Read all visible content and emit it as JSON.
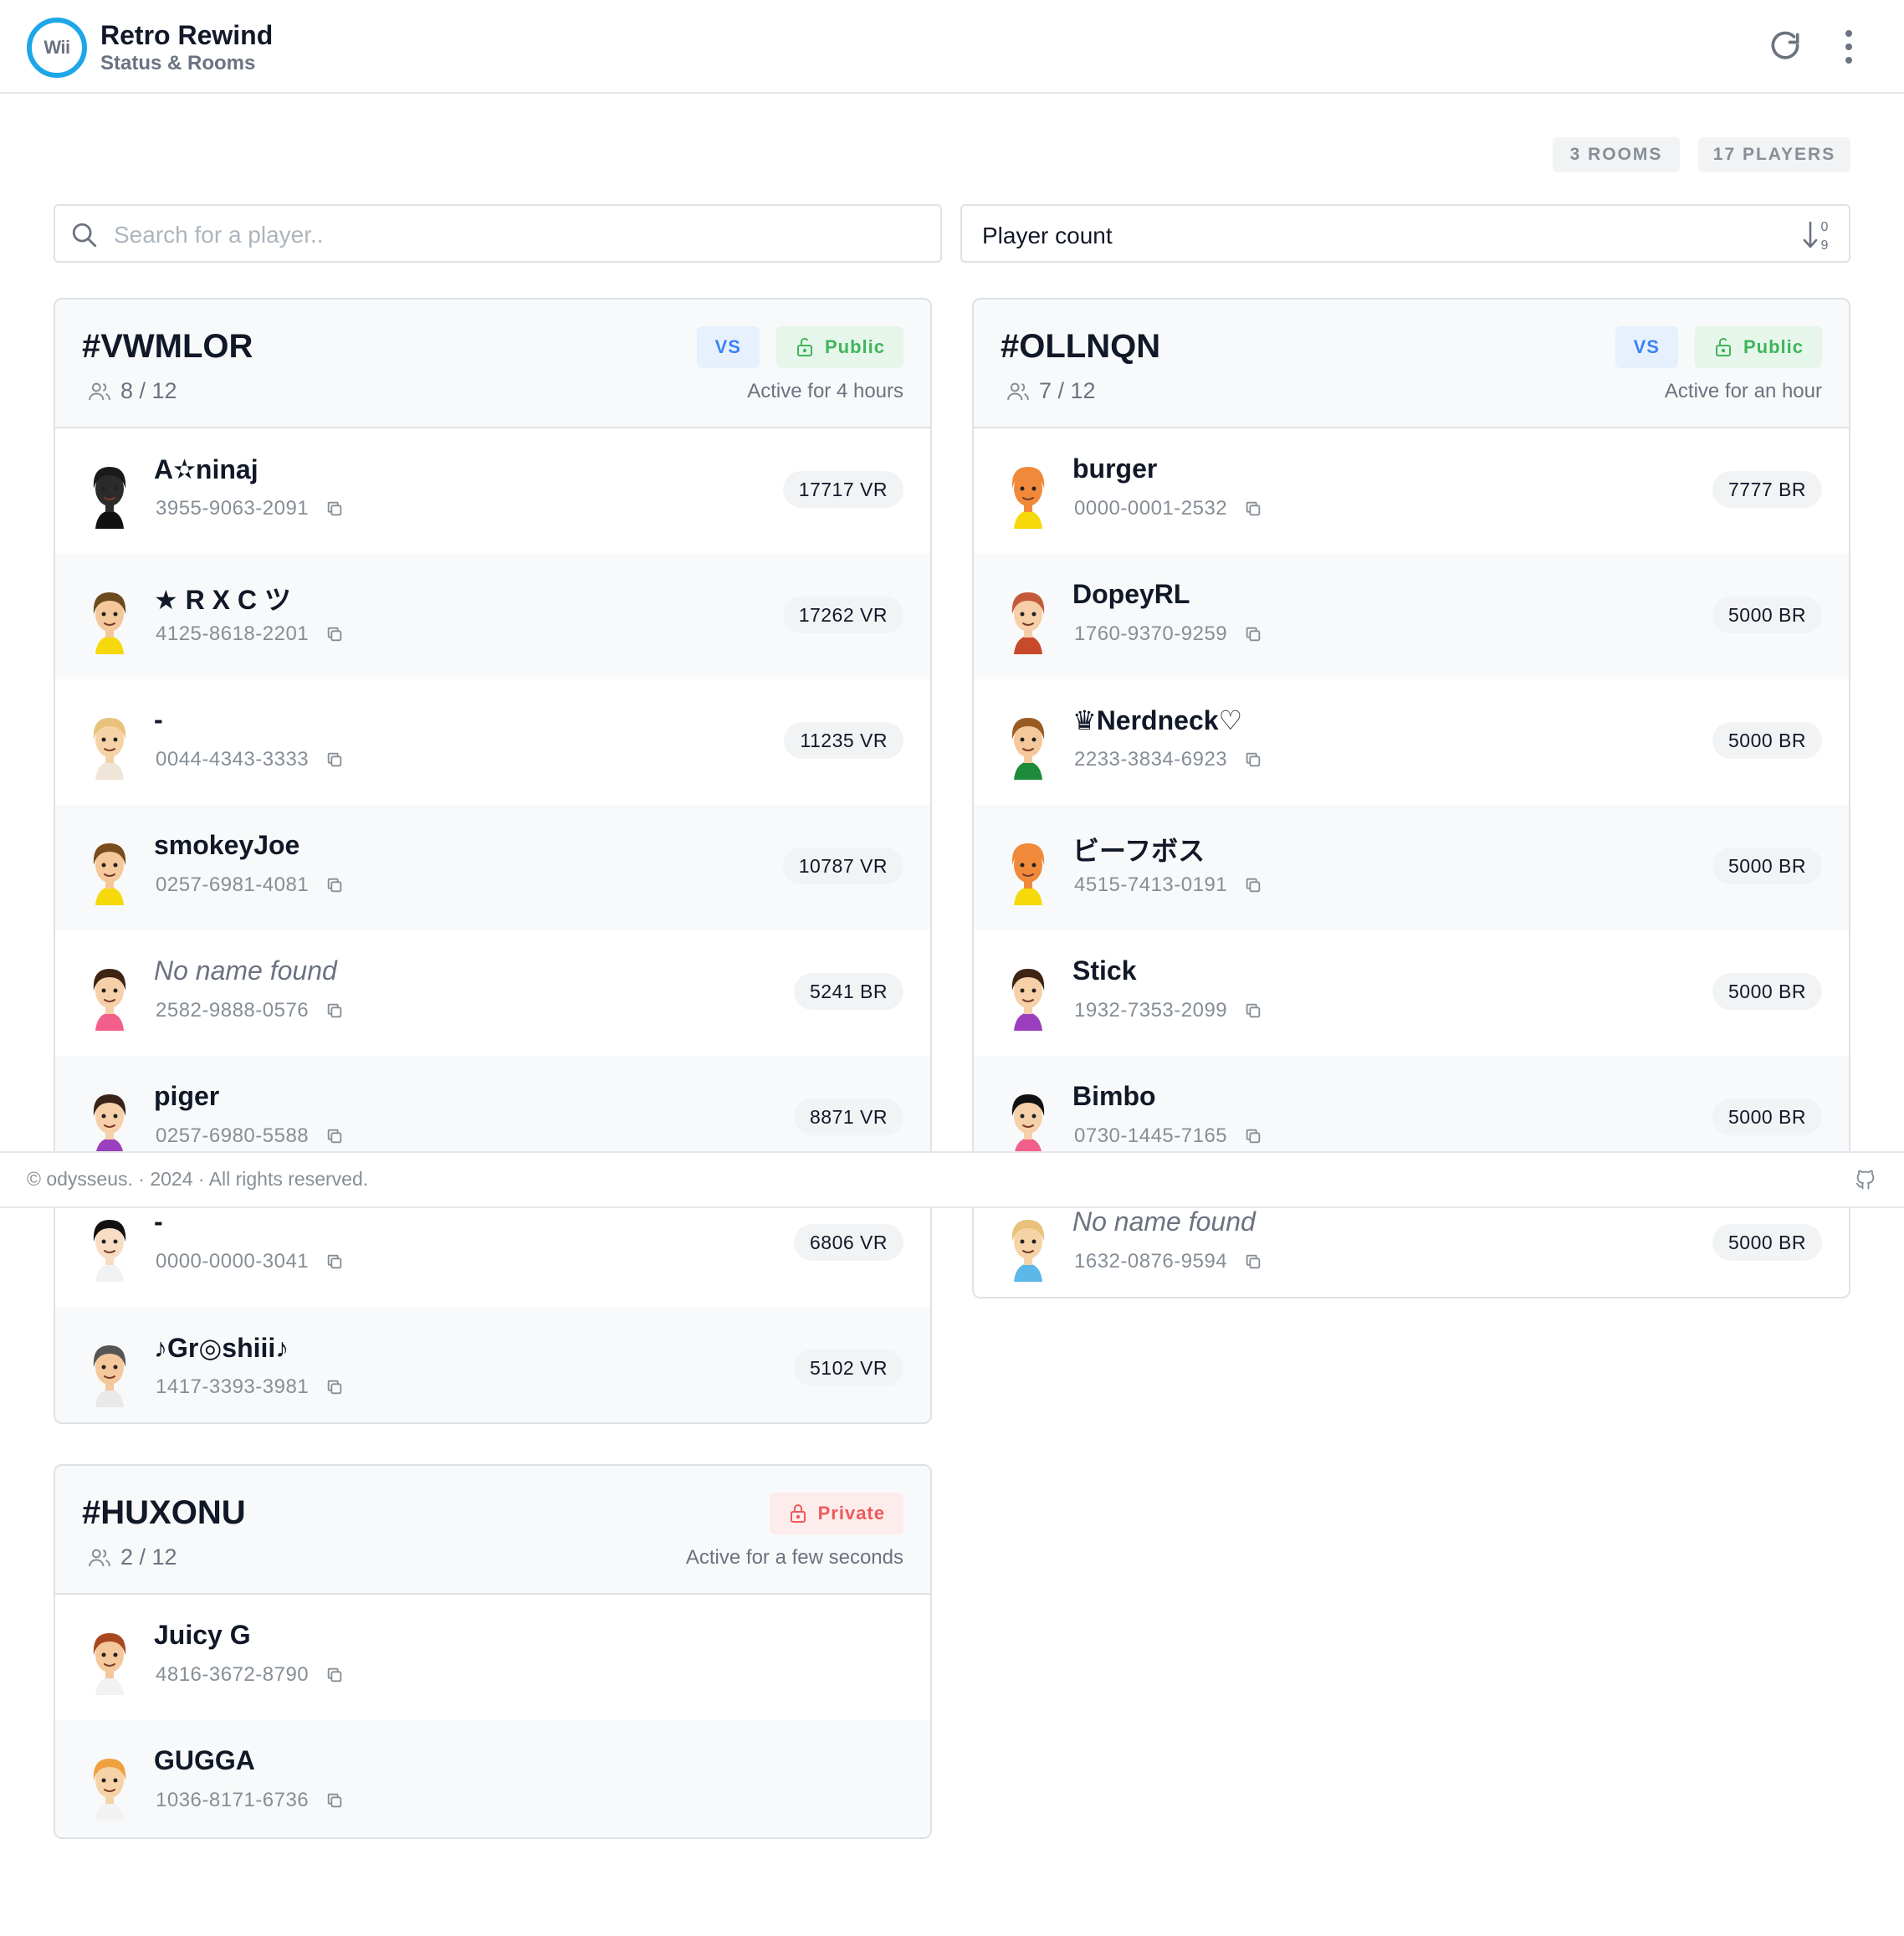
{
  "header": {
    "logo_text": "Wii",
    "title": "Retro Rewind",
    "subtitle": "Status & Rooms"
  },
  "stats": {
    "rooms": "3 ROOMS",
    "players": "17 PLAYERS"
  },
  "search": {
    "placeholder": "Search for a player.."
  },
  "sort": {
    "selected": "Player count"
  },
  "rooms": [
    {
      "id": "#VWMLOR",
      "count": "8 / 12",
      "mode": "VS",
      "access": "Public",
      "active": "Active for 4 hours",
      "players": [
        {
          "name": "A✫ninaj",
          "code": "3955-9063-2091",
          "rating": "17717 VR"
        },
        {
          "name": "★ R X C ツ",
          "code": "4125-8618-2201",
          "rating": "17262 VR"
        },
        {
          "name": "-",
          "code": "0044-4343-3333",
          "rating": "11235 VR"
        },
        {
          "name": "smokeyJoe",
          "code": "0257-6981-4081",
          "rating": "10787 VR"
        },
        {
          "name": "No name found",
          "code": "2582-9888-0576",
          "rating": "5241 BR"
        },
        {
          "name": "piger",
          "code": "0257-6980-5588",
          "rating": "8871 VR"
        },
        {
          "name": "-",
          "code": "0000-0000-3041",
          "rating": "6806 VR"
        },
        {
          "name": "♪Gr◎shiii♪",
          "code": "1417-3393-3981",
          "rating": "5102 VR"
        }
      ]
    },
    {
      "id": "#OLLNQN",
      "count": "7 / 12",
      "mode": "VS",
      "access": "Public",
      "active": "Active for an hour",
      "players": [
        {
          "name": "burger",
          "code": "0000-0001-2532",
          "rating": "7777 BR"
        },
        {
          "name": "DopeyRL",
          "code": "1760-9370-9259",
          "rating": "5000 BR"
        },
        {
          "name": "♛Nerdneck♡",
          "code": "2233-3834-6923",
          "rating": "5000 BR"
        },
        {
          "name": "ビーフボス",
          "code": "4515-7413-0191",
          "rating": "5000 BR"
        },
        {
          "name": "Stick",
          "code": "1932-7353-2099",
          "rating": "5000 BR"
        },
        {
          "name": "Bimbo",
          "code": "0730-1445-7165",
          "rating": "5000 BR"
        },
        {
          "name": "No name found",
          "code": "1632-0876-9594",
          "rating": "5000 BR"
        }
      ]
    },
    {
      "id": "#HUXONU",
      "count": "2 / 12",
      "access": "Private",
      "active": "Active for a few seconds",
      "players": [
        {
          "name": "Juicy G",
          "code": "4816-3672-8790"
        },
        {
          "name": "GUGGA",
          "code": "1036-8171-6736"
        }
      ]
    }
  ],
  "footer": {
    "text": "© odysseus. · 2024 · All rights reserved."
  },
  "colors": {
    "accent": "#1ea7e8",
    "vs": "#3b82f6",
    "public": "#40b55b",
    "private": "#ef5a5a"
  }
}
